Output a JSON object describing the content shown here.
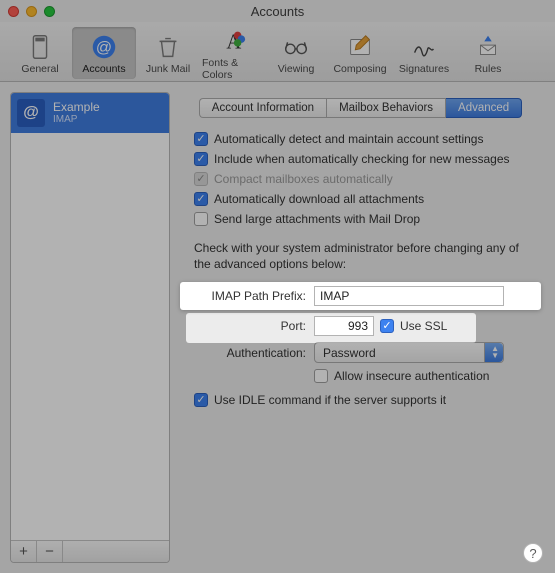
{
  "window": {
    "title": "Accounts"
  },
  "toolbar": {
    "items": [
      {
        "label": "General"
      },
      {
        "label": "Accounts"
      },
      {
        "label": "Junk Mail"
      },
      {
        "label": "Fonts & Colors"
      },
      {
        "label": "Viewing"
      },
      {
        "label": "Composing"
      },
      {
        "label": "Signatures"
      },
      {
        "label": "Rules"
      }
    ]
  },
  "sidebar": {
    "account_name": "Example",
    "account_type": "IMAP",
    "add_label": "+",
    "remove_label": "−"
  },
  "tabs": {
    "info": "Account Information",
    "mailbox": "Mailbox Behaviors",
    "advanced": "Advanced"
  },
  "options": {
    "opt1": "Automatically detect and maintain account settings",
    "opt2": "Include when automatically checking for new messages",
    "opt3": "Compact mailboxes automatically",
    "opt4": "Automatically download all attachments",
    "opt5": "Send large attachments with Mail Drop"
  },
  "admin_note": "Check with your system administrator before changing any of the advanced options below:",
  "form": {
    "path_prefix_label": "IMAP Path Prefix:",
    "path_prefix_value": "IMAP",
    "port_label": "Port:",
    "port_value": "993",
    "use_ssl_label": "Use SSL",
    "auth_label": "Authentication:",
    "auth_value": "Password",
    "allow_insecure_label": "Allow insecure authentication",
    "idle_label": "Use IDLE command if the server supports it"
  },
  "help_label": "?"
}
